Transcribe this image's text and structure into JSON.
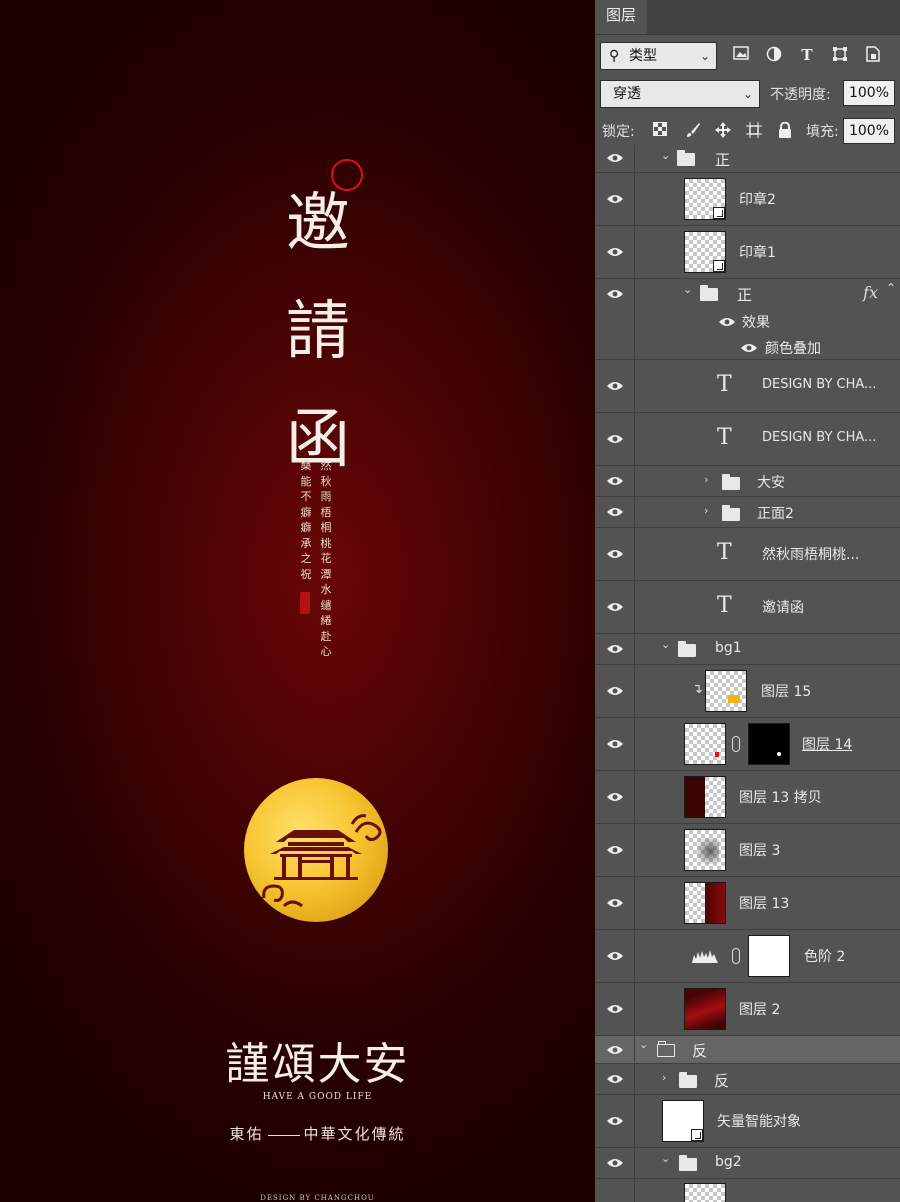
{
  "canvas": {
    "title_chars": [
      "邀",
      "請",
      "函"
    ],
    "poem_right": "然秋雨梧桐桃花潭水缱綣赴心",
    "poem_left": "桑能不癖癖承之祝",
    "main_title": "謹頌大安",
    "subtitle": "HAVE A GOOD LIFE",
    "tagline_left": "東佑",
    "tagline_right": "中華文化傳統",
    "credit": "DESIGN BY CHANGCHOU",
    "colors": {
      "background": "#4a0304",
      "moon": "#f7c531"
    }
  },
  "panel": {
    "tab": "图层",
    "filter": {
      "kind_icon": "⚲",
      "kind_label": "类型"
    },
    "blend_mode": "穿透",
    "opacity_label": "不透明度:",
    "opacity_value": "100%",
    "lock_label": "锁定:",
    "fill_label": "填充:",
    "fill_value": "100%",
    "layers": {
      "l0": "正",
      "l1": "印章2",
      "l2": "印章1",
      "l3": "正",
      "l3_effects": "效果",
      "l3_effect1": "颜色叠加",
      "l3_fx": "fx",
      "l4": "DESIGN BY CHA...",
      "l5": "DESIGN BY CHA...",
      "l6": "大安",
      "l7": "正面2",
      "l8": "然秋雨梧桐桃...",
      "l9": "邀请函",
      "l10": "bg1",
      "l11": "图层 15",
      "l12": "图层 14",
      "l13": "图层 13 拷贝",
      "l14": "图层 3",
      "l15": "图层 13",
      "l16": "色阶 2",
      "l17": "图层 2",
      "l18": "反",
      "l19": "反",
      "l20": "矢量智能对象",
      "l21": "bg2"
    }
  }
}
